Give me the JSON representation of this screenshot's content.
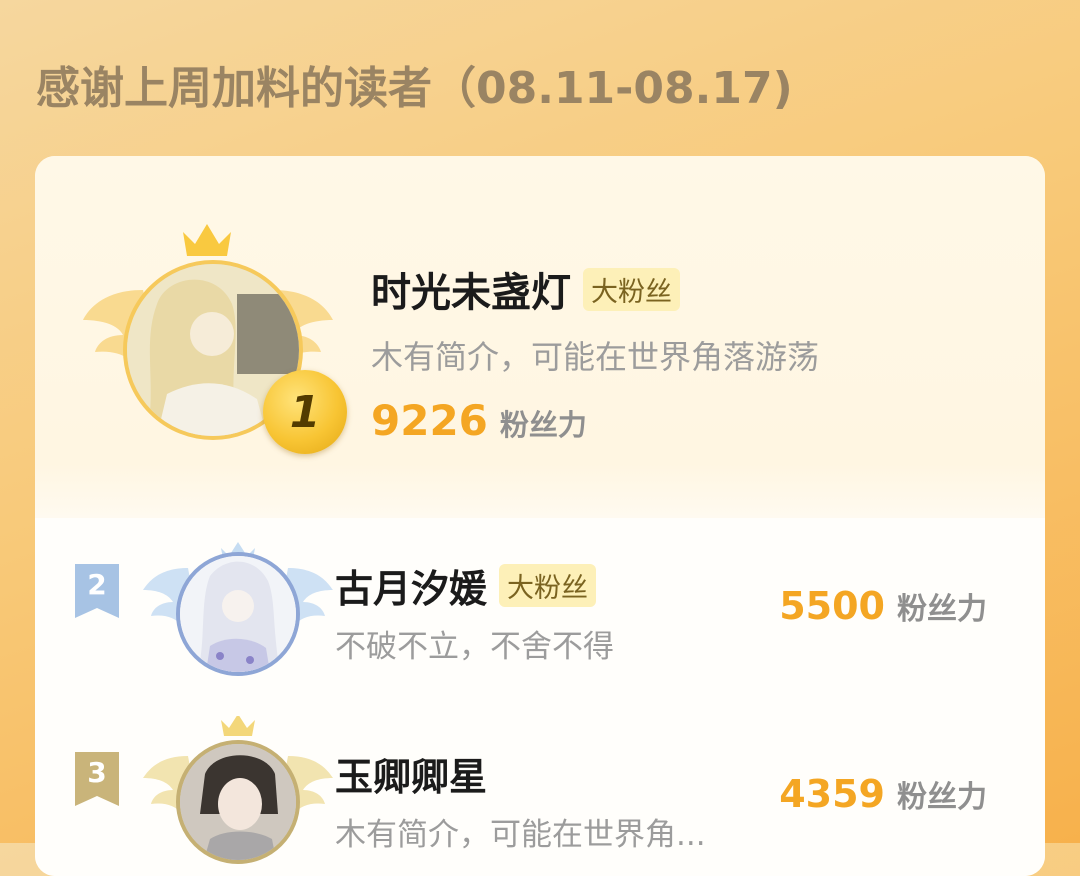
{
  "header": {
    "title": "感谢上周加料的读者（08.11-08.17)"
  },
  "colors": {
    "accent": "#f4a623",
    "badge_bg": "#fdf0b8",
    "gold": "#f6c95b",
    "silver_blue": "#a7c3e4",
    "bronze": "#c9b47a"
  },
  "top_fan": {
    "rank": "1",
    "name": "时光未盏灯",
    "badge": "大粉丝",
    "bio": "木有简介，可能在世界角落游荡",
    "power_value": "9226",
    "power_unit": "粉丝力",
    "icon": "crown-icon"
  },
  "fans": [
    {
      "rank": "2",
      "name": "古月汐媛",
      "badge": "大粉丝",
      "bio": "不破不立，不舍不得",
      "power_value": "5500",
      "power_unit": "粉丝力"
    },
    {
      "rank": "3",
      "name": "玉卿卿星",
      "badge": "",
      "bio": "木有简介，可能在世界角...",
      "power_value": "4359",
      "power_unit": "粉丝力"
    }
  ]
}
